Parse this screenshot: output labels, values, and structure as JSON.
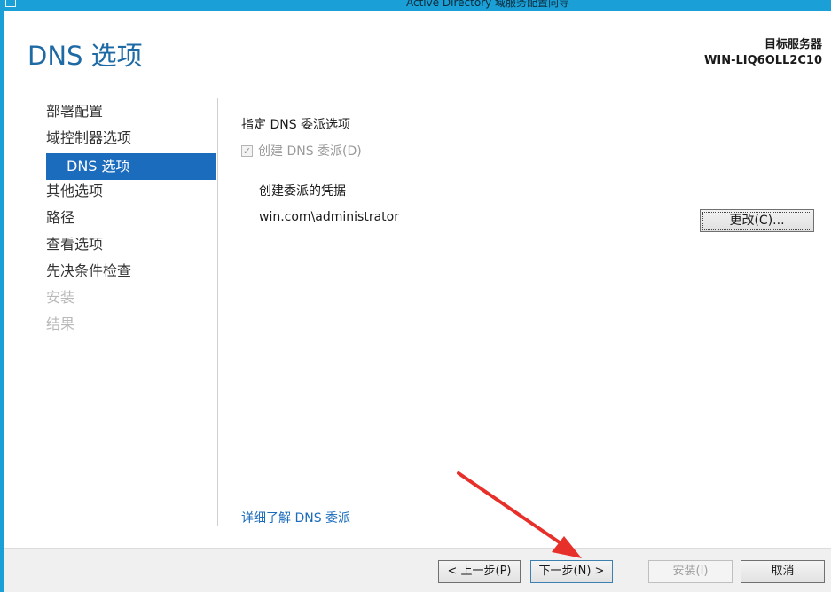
{
  "window": {
    "title": "Active Directory 域服务配置向导"
  },
  "header": {
    "page_title": "DNS 选项",
    "target_server_label": "目标服务器",
    "target_server_name": "WIN-LIQ6OLL2C10"
  },
  "nav": {
    "items": [
      {
        "label": "部署配置",
        "state": "normal"
      },
      {
        "label": "域控制器选项",
        "state": "normal"
      },
      {
        "label": "DNS 选项",
        "state": "active"
      },
      {
        "label": "其他选项",
        "state": "normal"
      },
      {
        "label": "路径",
        "state": "normal"
      },
      {
        "label": "查看选项",
        "state": "normal"
      },
      {
        "label": "先决条件检查",
        "state": "normal"
      },
      {
        "label": "安装",
        "state": "disabled"
      },
      {
        "label": "结果",
        "state": "disabled"
      }
    ]
  },
  "content": {
    "section_label": "指定 DNS 委派选项",
    "checkbox_label": "创建 DNS 委派(D)",
    "checkbox_checked": true,
    "credentials_label": "创建委派的凭据",
    "credentials_value": "win.com\\administrator",
    "change_button": "更改(C)..."
  },
  "learn_more_link": "详细了解 DNS 委派",
  "footer": {
    "prev_button": "< 上一步(P)",
    "next_button": "下一步(N) >",
    "install_button": "安装(I)",
    "cancel_button": "取消"
  },
  "colors": {
    "accent": "#1c6cbd",
    "title_blue": "#1e6aa5",
    "titlebar": "#1a9fd6",
    "annotation_arrow": "#e8302a"
  }
}
